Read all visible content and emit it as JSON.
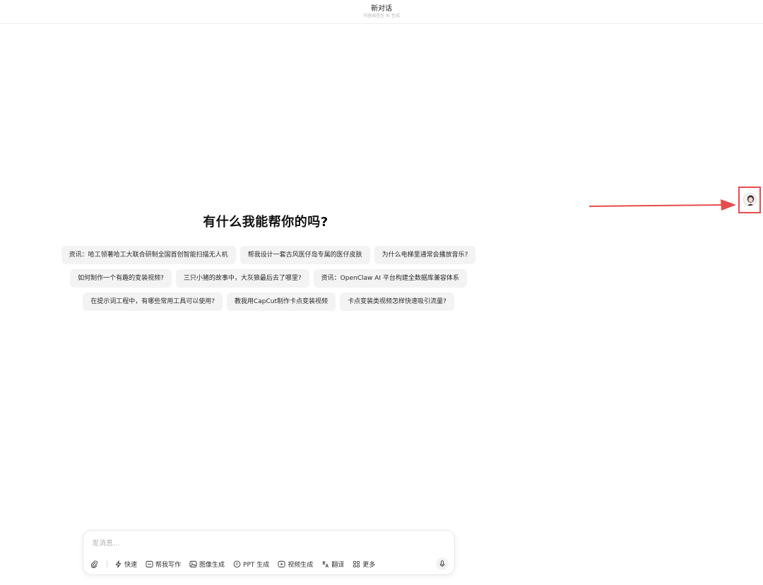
{
  "header": {
    "title": "新对话",
    "subtitle": "内容由豆包 AI 生成"
  },
  "main": {
    "heading": "有什么我能帮你的吗?",
    "suggestions": [
      [
        "资讯：哈工领著哈工大联合研制全国首创智能扫描无人机",
        "帮我设计一套古风医仔岛专属的医仔皮肤",
        "为什么电梯里通常会播放音乐?"
      ],
      [
        "如何制作一个有趣的变装视频?",
        "三只小猪的故事中，大灰狼最后去了哪里?",
        "资讯：OpenClaw AI 平台构建全数据库兼容体系"
      ],
      [
        "在提示词工程中，有哪些常用工具可以使用?",
        "教我用CapCut制作卡点变装视频",
        "卡点变装类视频怎样快速吸引流量?"
      ]
    ]
  },
  "composer": {
    "placeholder": "发消息...",
    "tools": {
      "attach": "attachment-icon",
      "fast": "快速",
      "write": "帮我写作",
      "image": "图像生成",
      "ppt": "PPT 生成",
      "video": "视频生成",
      "translate": "翻译",
      "more": "更多"
    }
  },
  "colors": {
    "annotation": "#e74b4b",
    "chip_bg": "#f3f3f4"
  }
}
